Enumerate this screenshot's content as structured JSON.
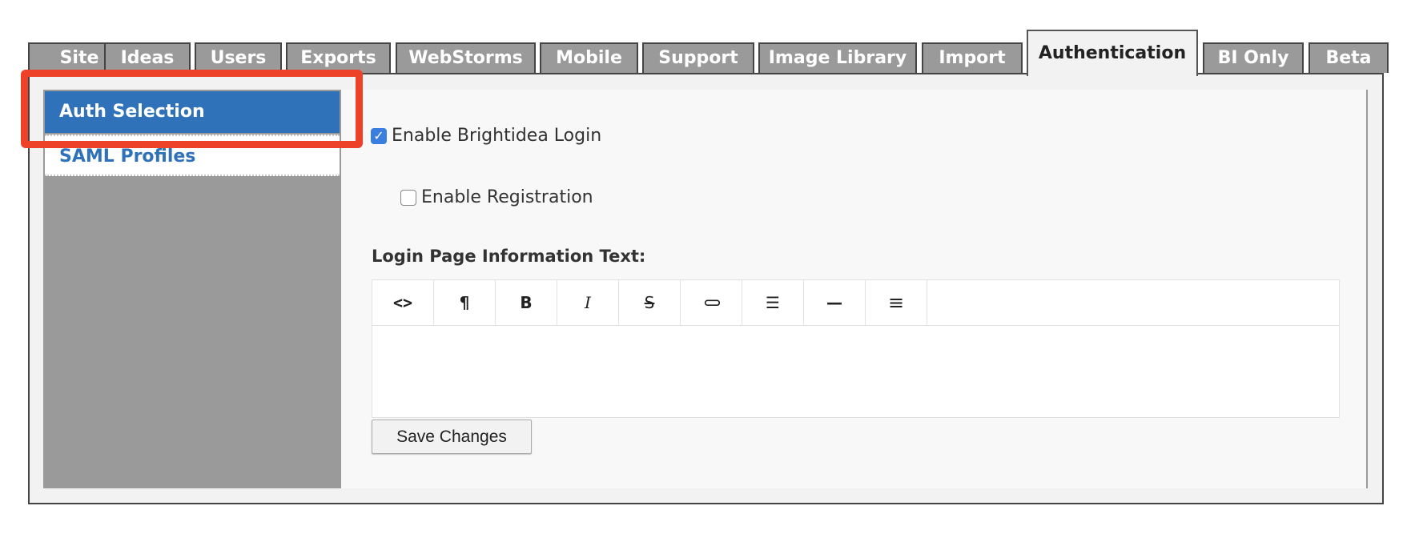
{
  "tabs": [
    {
      "label": "Site",
      "active": false
    },
    {
      "label": "Ideas",
      "active": false
    },
    {
      "label": "Users",
      "active": false
    },
    {
      "label": "Exports",
      "active": false
    },
    {
      "label": "WebStorms",
      "active": false
    },
    {
      "label": "Mobile",
      "active": false
    },
    {
      "label": "Support",
      "active": false
    },
    {
      "label": "Image Library",
      "active": false
    },
    {
      "label": "Import",
      "active": false
    },
    {
      "label": "Authentication",
      "active": true
    },
    {
      "label": "BI Only",
      "active": false
    },
    {
      "label": "Beta",
      "active": false
    }
  ],
  "sidebar": {
    "items": [
      {
        "label": "Auth Selection",
        "active": true
      },
      {
        "label": "SAML Profiles",
        "active": false
      }
    ]
  },
  "form": {
    "enable_login": {
      "label": "Enable Brightidea Login",
      "checked": true
    },
    "enable_registration": {
      "label": "Enable Registration",
      "checked": false
    },
    "info_text_label": "Login Page Information Text:",
    "info_text_value": "",
    "save_label": "Save Changes"
  },
  "editor_toolbar": [
    {
      "icon": "code-icon",
      "glyph": "<>"
    },
    {
      "icon": "paragraph-icon",
      "glyph": "¶"
    },
    {
      "icon": "bold-icon",
      "glyph": "B"
    },
    {
      "icon": "italic-icon",
      "glyph": "I"
    },
    {
      "icon": "strikethrough-icon",
      "glyph": "S"
    },
    {
      "icon": "link-icon",
      "glyph": "⊂⊃"
    },
    {
      "icon": "list-icon",
      "glyph": "☰"
    },
    {
      "icon": "horizontal-rule-icon",
      "glyph": "—"
    },
    {
      "icon": "align-left-icon",
      "glyph": "≡"
    }
  ],
  "colors": {
    "accent": "#2f72ba",
    "tab_bg": "#9a9a9a",
    "highlight": "#ee4228",
    "checkbox": "#3a7ee0"
  }
}
